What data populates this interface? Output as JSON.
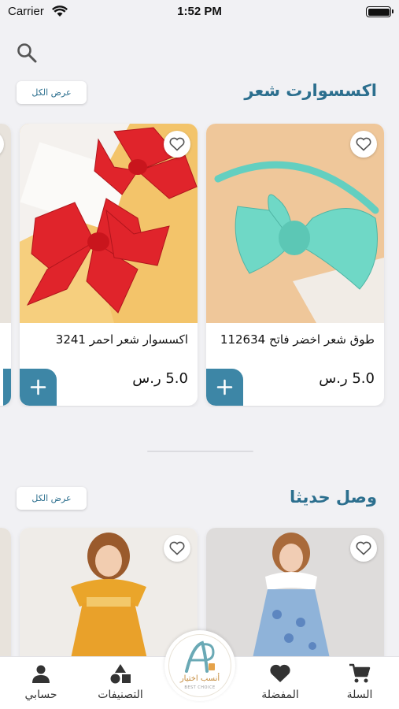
{
  "status_bar": {
    "carrier": "Carrier",
    "time": "1:52 PM"
  },
  "sections": [
    {
      "title": "اكسسوارت شعر",
      "view_all": "عرض الكل",
      "products": [
        {
          "name": "طوق شعر اخضر فاتح 112634",
          "price": "5.0 ر.س"
        },
        {
          "name": "اكسسوار شعر احمر 3241",
          "price": "5.0 ر.س"
        }
      ]
    },
    {
      "title": "وصل حديثا",
      "view_all": "عرض الكل"
    }
  ],
  "tabbar": {
    "cart": "السلة",
    "favorites": "المفضلة",
    "categories": "التصنيفات",
    "account": "حسابي"
  },
  "logo": {
    "text": "أنسب اختيار",
    "sub": "BEST CHOICE"
  },
  "colors": {
    "accent": "#2c6f8e",
    "button": "#3d86a6",
    "background": "#f1f1f4"
  },
  "icons": [
    "search-icon",
    "heart-outline-icon",
    "plus-icon",
    "cart-icon",
    "heart-filled-icon",
    "shapes-icon",
    "person-icon",
    "wifi-icon",
    "battery-icon"
  ]
}
